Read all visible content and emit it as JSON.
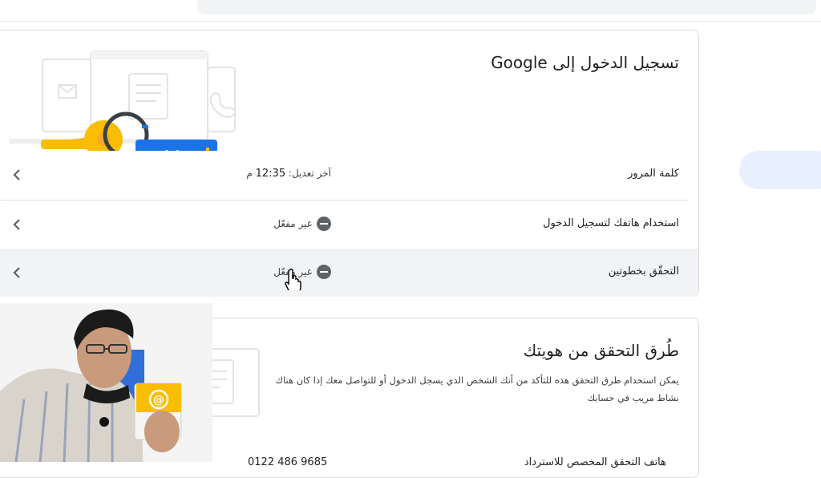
{
  "signin_card": {
    "title": "تسجيل الدخول إلى Google",
    "rows": [
      {
        "label": "كلمة المرور",
        "value_prefix": "آخر تعديل: ",
        "time": "12:35",
        "suffix": " م"
      },
      {
        "label": "استخدام هاتفك لتسجيل الدخول",
        "status": "غير مفعّل"
      },
      {
        "label": "التحقّق بخطوتين",
        "status": "غير مفعّل"
      }
    ]
  },
  "identity_card": {
    "title": "طُرق التحقق من هويتك",
    "description": "يمكن استخدام طرق التحقق هذه للتأكد من أنك الشخص الذي يسجل الدخول أو للتواصل معك إذا كان هناك نشاط مريب في حسابك",
    "partial_row": {
      "label": "هاتف التحقق المخصص للاسترداد",
      "value": "0122 486 9685"
    }
  },
  "illustration": {
    "password_mask": "**"
  },
  "colors": {
    "accent_blue": "#1a73e8",
    "key_yellow": "#fbbc04",
    "icon_gray": "#5f6368",
    "highlight": "#f1f3f4"
  },
  "icons": [
    "chevron-left-icon",
    "minus-circle-icon",
    "key-icon",
    "envelope-icon",
    "phone-icon",
    "cursor-hand-icon"
  ]
}
